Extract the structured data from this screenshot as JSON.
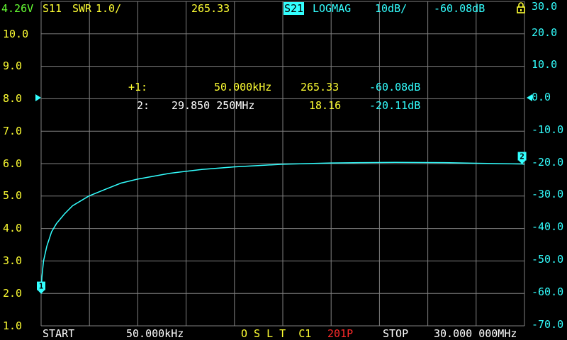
{
  "status": {
    "battery_voltage": "4.26V",
    "trace1": {
      "channel": "S11",
      "format": "SWR",
      "scale": "1.0/",
      "value": "265.33"
    },
    "trace2": {
      "channel": "S21",
      "format": "LOGMAG",
      "scale": "10dB/",
      "value": "-60.08dB"
    },
    "lock_icon": "padlock-icon"
  },
  "left_axis": {
    "labels": [
      "10.0",
      "9.0",
      "8.0",
      "7.0",
      "6.0",
      "5.0",
      "4.0",
      "3.0",
      "2.0",
      "1.0"
    ]
  },
  "right_axis": {
    "labels": [
      "30.0",
      "20.0",
      "10.0",
      "0.0",
      "-10.0",
      "-20.0",
      "-30.0",
      "-40.0",
      "-50.0",
      "-60.0",
      "-70.0"
    ]
  },
  "markers": {
    "m1": {
      "prefix": "+1:",
      "freq": "50.000kHz",
      "swr": "265.33",
      "db": "-60.08dB"
    },
    "m2": {
      "prefix": "2:",
      "freq": "29.850 250MHz",
      "swr": "18.16",
      "db": "-20.11dB"
    }
  },
  "footer": {
    "start_label": "START",
    "start_value": "50.000kHz",
    "cal_status": "O S L T  C1",
    "points": "201P",
    "stop_label": "STOP",
    "stop_value": "30.000 000MHz"
  },
  "chart_data": {
    "type": "line",
    "series": [
      {
        "channel": "S21",
        "x_mhz": [
          0.05,
          0.1,
          0.2,
          0.4,
          0.7,
          1.0,
          1.5,
          2.0,
          3.0,
          4.0,
          5.0,
          6.0,
          8.0,
          10.0,
          12.0,
          15.0,
          18.0,
          20.0,
          22.0,
          25.0,
          27.0,
          29.85,
          30.0
        ],
        "db": [
          -60.08,
          -55.0,
          -50.0,
          -45.5,
          -41.0,
          -38.5,
          -35.5,
          -33.0,
          -30.0,
          -28.0,
          -26.0,
          -24.8,
          -23.0,
          -21.8,
          -21.0,
          -20.2,
          -19.8,
          -19.7,
          -19.6,
          -19.7,
          -19.9,
          -20.11,
          -20.2
        ]
      }
    ],
    "x_range_mhz": [
      0.05,
      30.0
    ],
    "left_range": [
      1.0,
      10.0
    ],
    "right_range_db": [
      -70.0,
      30.0
    ],
    "grid": true,
    "colors": {
      "s11": "#ffff33",
      "s21": "#33ffff",
      "grid": "#808080"
    }
  }
}
